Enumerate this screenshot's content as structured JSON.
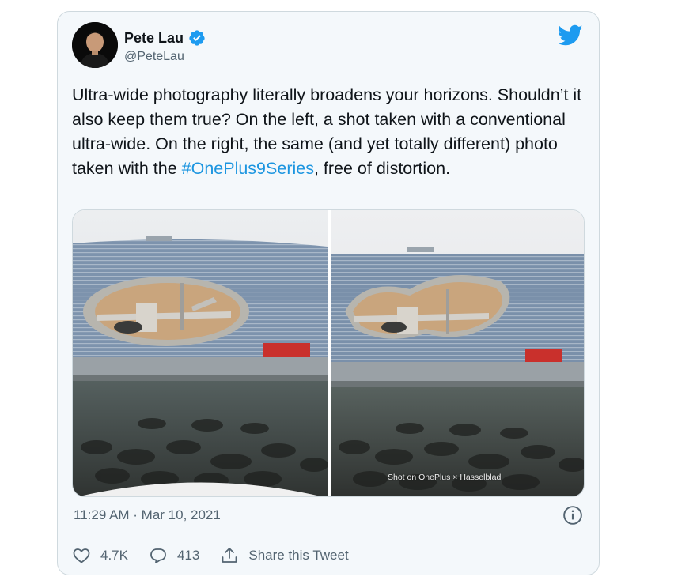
{
  "tweet": {
    "author_name": "Pete Lau",
    "author_handle": "@PeteLau",
    "text_before_hashtag": "Ultra-wide photography literally broadens your horizons. Shouldn’t it also keep them true? On the left, a shot taken with a conventional ultra-wide. On the right, the same (and yet totally different) photo taken with the ",
    "hashtag": "#OnePlus9Series",
    "text_after_hashtag": ", free of distortion.",
    "timestamp": "11:29 AM · Mar 10, 2021",
    "watermark": "Shot on OnePlus × Hasselblad"
  },
  "actions": {
    "likes": "4.7K",
    "replies": "413",
    "share_label": "Share this Tweet"
  },
  "icons": {
    "verified": "verified-badge-icon",
    "logo": "twitter-bird-icon",
    "info": "info-icon",
    "like": "heart-icon",
    "reply": "reply-bubble-icon",
    "share": "share-icon"
  },
  "colors": {
    "hashtag": "#1b95e0",
    "verified": "#1d9bf0",
    "logo": "#1d9bf0",
    "card_bg": "#f4f8fb",
    "muted_text": "#536471"
  }
}
